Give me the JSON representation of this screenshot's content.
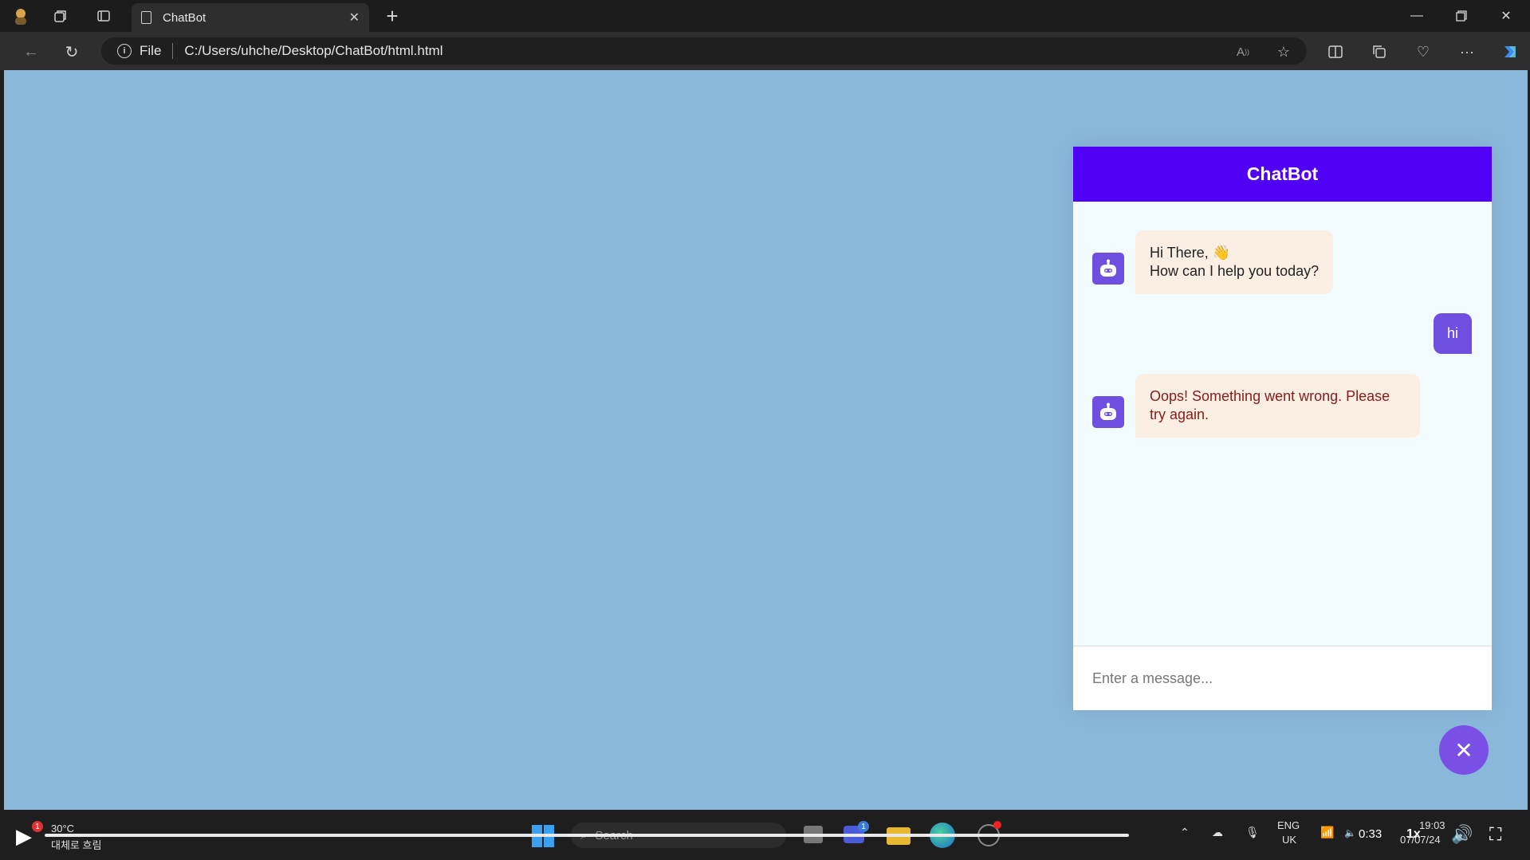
{
  "browser": {
    "tab_title": "ChatBot",
    "protocol_label": "File",
    "url": "C:/Users/uhche/Desktop/ChatBot/html.html"
  },
  "chatbot": {
    "header_title": "ChatBot",
    "messages": [
      {
        "role": "bot",
        "text": "Hi There, 👋\nHow can I help you today?"
      },
      {
        "role": "user",
        "text": "hi"
      },
      {
        "role": "bot",
        "text": "Oops! Something went wrong. Please try again.",
        "error": true
      }
    ],
    "input_placeholder": "Enter a message...",
    "toggler_icon": "✕"
  },
  "colors": {
    "header": "#5100f6",
    "accent": "#6e4fe0",
    "page_background": "#8ab8db",
    "chat_background": "#f2fbfe",
    "incoming_bubble": "#fbefe3",
    "error_text": "#8a1a1a"
  },
  "taskbar": {
    "weather_temp": "30°C",
    "weather_desc": "대체로 흐림",
    "weather_badge": "1",
    "search_placeholder": "Search",
    "teams_badge": "1",
    "language": "ENG",
    "region": "UK",
    "playback_time": "0:33",
    "speed": "1x",
    "clock_time": "19:03",
    "clock_date": "07/07/24"
  }
}
